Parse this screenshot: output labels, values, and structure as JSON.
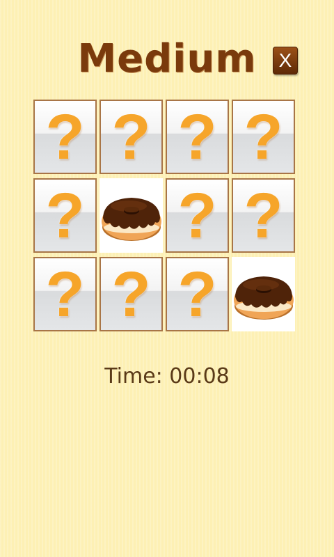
{
  "header": {
    "title": "Medium",
    "close_label": "X"
  },
  "board": {
    "cards": [
      {
        "state": "hidden",
        "symbol": "?",
        "icon": "question-mark-icon"
      },
      {
        "state": "hidden",
        "symbol": "?",
        "icon": "question-mark-icon"
      },
      {
        "state": "hidden",
        "symbol": "?",
        "icon": "question-mark-icon"
      },
      {
        "state": "hidden",
        "symbol": "?",
        "icon": "question-mark-icon"
      },
      {
        "state": "hidden",
        "symbol": "?",
        "icon": "question-mark-icon"
      },
      {
        "state": "revealed",
        "symbol": "",
        "icon": "chocolate-donut-icon"
      },
      {
        "state": "hidden",
        "symbol": "?",
        "icon": "question-mark-icon"
      },
      {
        "state": "hidden",
        "symbol": "?",
        "icon": "question-mark-icon"
      },
      {
        "state": "hidden",
        "symbol": "?",
        "icon": "question-mark-icon"
      },
      {
        "state": "hidden",
        "symbol": "?",
        "icon": "question-mark-icon"
      },
      {
        "state": "hidden",
        "symbol": "?",
        "icon": "question-mark-icon"
      },
      {
        "state": "revealed",
        "symbol": "",
        "icon": "chocolate-donut-icon"
      }
    ]
  },
  "status": {
    "time_text": "Time: 00:08"
  },
  "colors": {
    "background": "#fdf0b4",
    "title": "#7a3a0c",
    "card_border": "#a87547",
    "question_mark": "#f6a52a",
    "timer_text": "#5a3a18"
  }
}
